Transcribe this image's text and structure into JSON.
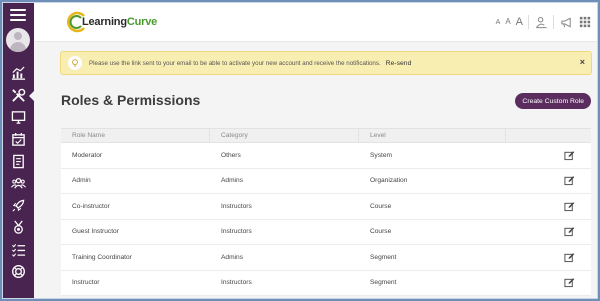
{
  "app": {
    "logo_part1": "Learning",
    "logo_part2": "Curve"
  },
  "header": {
    "font_small": "A",
    "font_medium": "A",
    "font_large": "A",
    "icons": [
      "user-settings-icon",
      "megaphone-icon",
      "apps-grid-icon"
    ]
  },
  "sidebar": {
    "items": [
      {
        "icon": "analytics-icon"
      },
      {
        "icon": "tools-icon",
        "active": true
      },
      {
        "icon": "monitor-icon"
      },
      {
        "icon": "calendar-icon"
      },
      {
        "icon": "document-icon"
      },
      {
        "icon": "users-icon"
      },
      {
        "icon": "rocket-icon"
      },
      {
        "icon": "badge-icon"
      },
      {
        "icon": "checklist-icon"
      },
      {
        "icon": "help-ring-icon"
      }
    ]
  },
  "notice": {
    "text": "Please use the link sent to your email to be able to activate your new account and receive the notifications.",
    "link": "Re-send",
    "close": "×"
  },
  "page": {
    "title": "Roles & Permissions",
    "create_button": "Create Custom Role"
  },
  "table": {
    "headers": [
      "Role Name",
      "Category",
      "Level",
      ""
    ],
    "rows": [
      {
        "name": "Moderator",
        "category": "Others",
        "level": "System"
      },
      {
        "name": "Admin",
        "category": "Admins",
        "level": "Organization"
      },
      {
        "name": "Co-instructor",
        "category": "Instructors",
        "level": "Course"
      },
      {
        "name": "Guest Instructor",
        "category": "Instructors",
        "level": "Course"
      },
      {
        "name": "Training Coordinator",
        "category": "Admins",
        "level": "Segment"
      },
      {
        "name": "Instructor",
        "category": "Instructors",
        "level": "Segment"
      }
    ]
  },
  "colors": {
    "sidebar": "#4a2450",
    "accent": "#5a2d5e",
    "notice_bg": "#f9eeb2",
    "logo_green": "#4a9a2e"
  }
}
